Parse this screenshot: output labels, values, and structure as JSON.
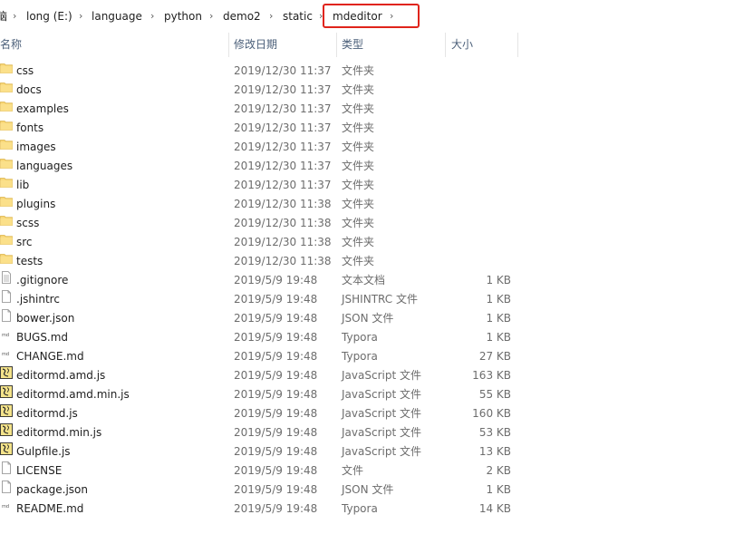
{
  "breadcrumb": {
    "items": [
      {
        "label": "脑"
      },
      {
        "label": "long (E:)"
      },
      {
        "label": "language"
      },
      {
        "label": "python"
      },
      {
        "label": "demo2"
      },
      {
        "label": "static"
      },
      {
        "label": "mdeditor"
      }
    ],
    "separator": "›"
  },
  "columns": {
    "name": "名称",
    "modified": "修改日期",
    "type": "类型",
    "size": "大小"
  },
  "files": [
    {
      "name": "css",
      "modified": "2019/12/30 11:37",
      "type": "文件夹",
      "size": "",
      "icon": "folder-icon"
    },
    {
      "name": "docs",
      "modified": "2019/12/30 11:37",
      "type": "文件夹",
      "size": "",
      "icon": "folder-icon"
    },
    {
      "name": "examples",
      "modified": "2019/12/30 11:37",
      "type": "文件夹",
      "size": "",
      "icon": "folder-icon"
    },
    {
      "name": "fonts",
      "modified": "2019/12/30 11:37",
      "type": "文件夹",
      "size": "",
      "icon": "folder-icon"
    },
    {
      "name": "images",
      "modified": "2019/12/30 11:37",
      "type": "文件夹",
      "size": "",
      "icon": "folder-icon"
    },
    {
      "name": "languages",
      "modified": "2019/12/30 11:37",
      "type": "文件夹",
      "size": "",
      "icon": "folder-icon"
    },
    {
      "name": "lib",
      "modified": "2019/12/30 11:37",
      "type": "文件夹",
      "size": "",
      "icon": "folder-icon"
    },
    {
      "name": "plugins",
      "modified": "2019/12/30 11:38",
      "type": "文件夹",
      "size": "",
      "icon": "folder-icon"
    },
    {
      "name": "scss",
      "modified": "2019/12/30 11:38",
      "type": "文件夹",
      "size": "",
      "icon": "folder-icon"
    },
    {
      "name": "src",
      "modified": "2019/12/30 11:38",
      "type": "文件夹",
      "size": "",
      "icon": "folder-icon"
    },
    {
      "name": "tests",
      "modified": "2019/12/30 11:38",
      "type": "文件夹",
      "size": "",
      "icon": "folder-icon"
    },
    {
      "name": ".gitignore",
      "modified": "2019/5/9 19:48",
      "type": "文本文档",
      "size": "1 KB",
      "icon": "text-file-icon"
    },
    {
      "name": ".jshintrc",
      "modified": "2019/5/9 19:48",
      "type": "JSHINTRC 文件",
      "size": "1 KB",
      "icon": "blank-file-icon"
    },
    {
      "name": "bower.json",
      "modified": "2019/5/9 19:48",
      "type": "JSON 文件",
      "size": "1 KB",
      "icon": "blank-file-icon"
    },
    {
      "name": "BUGS.md",
      "modified": "2019/5/9 19:48",
      "type": "Typora",
      "size": "1 KB",
      "icon": "markdown-file-icon"
    },
    {
      "name": "CHANGE.md",
      "modified": "2019/5/9 19:48",
      "type": "Typora",
      "size": "27 KB",
      "icon": "markdown-file-icon"
    },
    {
      "name": "editormd.amd.js",
      "modified": "2019/5/9 19:48",
      "type": "JavaScript 文件",
      "size": "163 KB",
      "icon": "script-file-icon"
    },
    {
      "name": "editormd.amd.min.js",
      "modified": "2019/5/9 19:48",
      "type": "JavaScript 文件",
      "size": "55 KB",
      "icon": "script-file-icon"
    },
    {
      "name": "editormd.js",
      "modified": "2019/5/9 19:48",
      "type": "JavaScript 文件",
      "size": "160 KB",
      "icon": "script-file-icon"
    },
    {
      "name": "editormd.min.js",
      "modified": "2019/5/9 19:48",
      "type": "JavaScript 文件",
      "size": "53 KB",
      "icon": "script-file-icon"
    },
    {
      "name": "Gulpfile.js",
      "modified": "2019/5/9 19:48",
      "type": "JavaScript 文件",
      "size": "13 KB",
      "icon": "script-file-icon"
    },
    {
      "name": "LICENSE",
      "modified": "2019/5/9 19:48",
      "type": "文件",
      "size": "2 KB",
      "icon": "blank-file-icon"
    },
    {
      "name": "package.json",
      "modified": "2019/5/9 19:48",
      "type": "JSON 文件",
      "size": "1 KB",
      "icon": "blank-file-icon"
    },
    {
      "name": "README.md",
      "modified": "2019/5/9 19:48",
      "type": "Typora",
      "size": "14 KB",
      "icon": "markdown-file-icon"
    }
  ],
  "colors": {
    "highlight": "#e0241b",
    "folder": "#f8d675",
    "header_text": "#4c607a"
  }
}
